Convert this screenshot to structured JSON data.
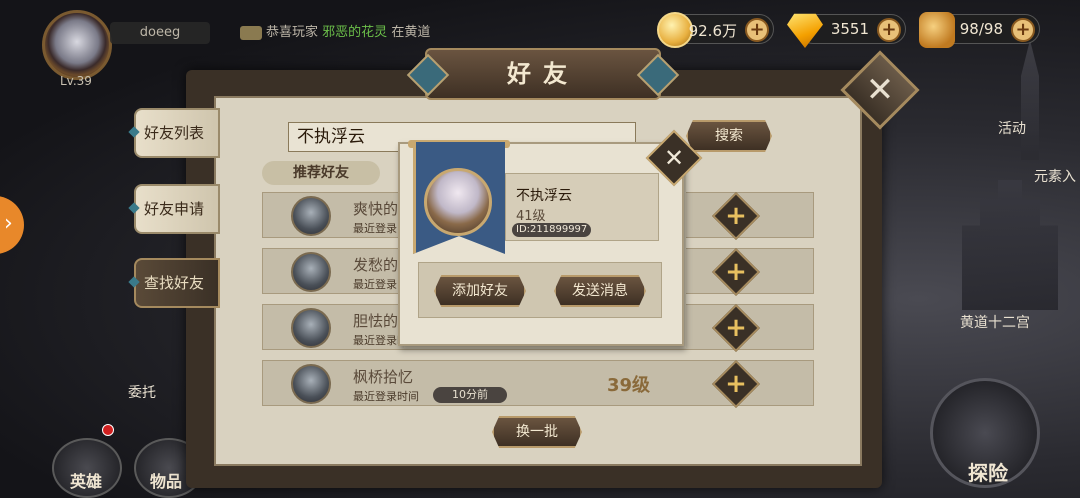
{
  "player": {
    "name": "doeeg",
    "level": "Lv.39"
  },
  "chat": {
    "prefix": "恭喜玩家",
    "highlight": "邪恶的花灵",
    "suffix": "在黄道"
  },
  "resources": [
    {
      "icon": "gold-coin-icon",
      "value": "92.6万"
    },
    {
      "icon": "diamond-icon",
      "value": "3551"
    },
    {
      "icon": "stamina-icon",
      "value": "98/98"
    }
  ],
  "panel": {
    "title": "好友"
  },
  "tabs": [
    {
      "label": "好友列表",
      "active": false
    },
    {
      "label": "好友申请",
      "active": false
    },
    {
      "label": "查找好友",
      "active": true
    }
  ],
  "search": {
    "value": "不执浮云",
    "button": "搜索"
  },
  "recommend": {
    "title": "推荐好友",
    "rows": [
      {
        "name": "爽快的",
        "last_label": "最近登录",
        "ago": "",
        "level": ""
      },
      {
        "name": "发愁的",
        "last_label": "最近登录",
        "ago": "",
        "level": ""
      },
      {
        "name": "胆怯的",
        "last_label": "最近登录时间",
        "ago": "",
        "level": ""
      },
      {
        "name": "枫桥拾忆",
        "last_label": "最近登录时间",
        "ago": "10分前",
        "level": "39级"
      }
    ],
    "refresh_button": "换一批"
  },
  "popup": {
    "name": "不执浮云",
    "level": "41级",
    "id": "ID:211899997",
    "add_button": "添加好友",
    "message_button": "发送消息"
  },
  "side": {
    "activity": "活动",
    "element": "元素入",
    "zodiac": "黄道十二宫",
    "commission": "委托",
    "hero": "英雄",
    "items": "物品",
    "explore": "探险"
  },
  "colors": {
    "accent_gold": "#e8c060",
    "panel_dark": "#3a3026",
    "parchment": "#d9d2c0",
    "banner_blue": "#3a5a84"
  }
}
